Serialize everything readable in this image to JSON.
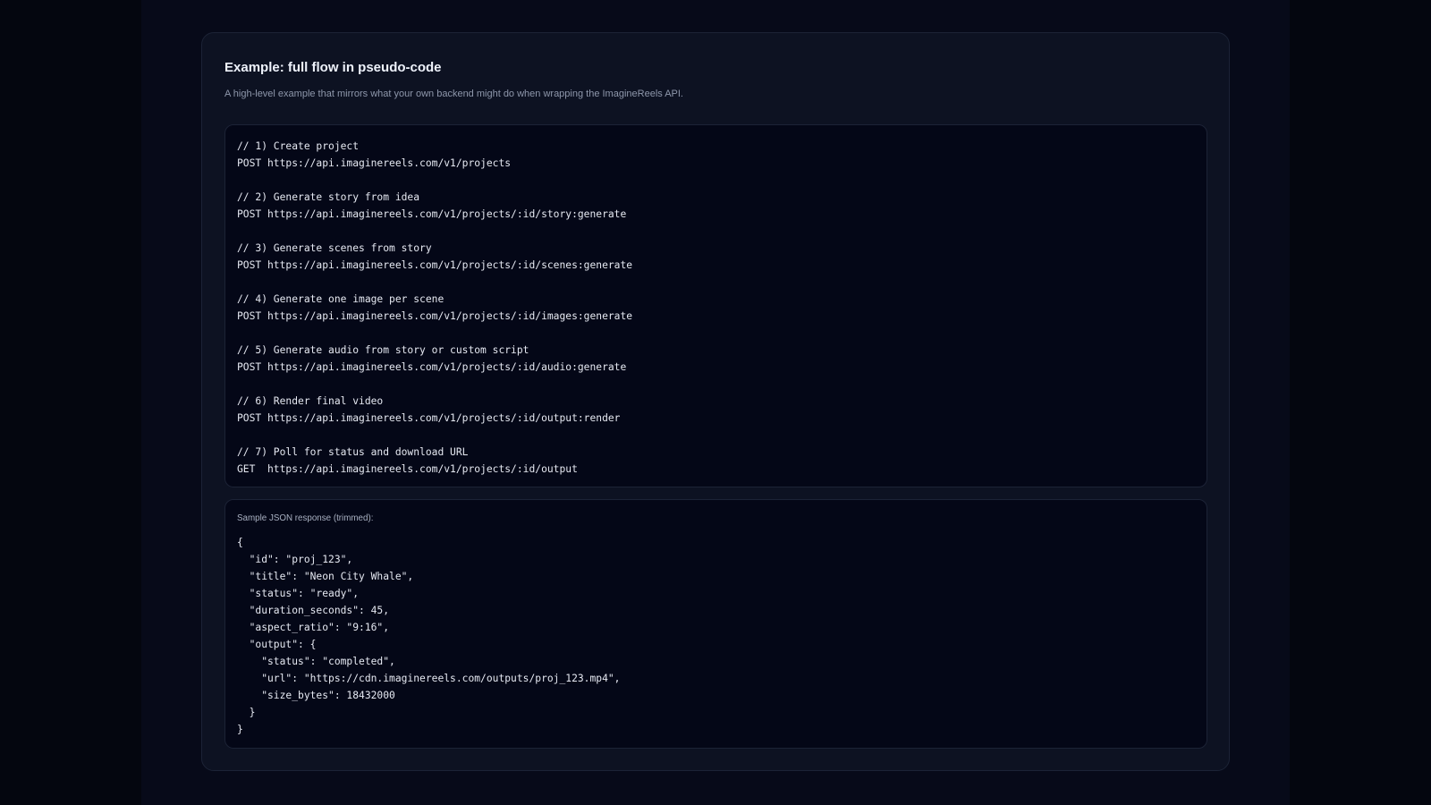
{
  "example_card": {
    "title": "Example: full flow in pseudo-code",
    "subtitle": "A high-level example that mirrors what your own backend might do when wrapping the ImagineReels API.",
    "flow_code": "// 1) Create project\nPOST https://api.imaginereels.com/v1/projects\n\n// 2) Generate story from idea\nPOST https://api.imaginereels.com/v1/projects/:id/story:generate\n\n// 3) Generate scenes from story\nPOST https://api.imaginereels.com/v1/projects/:id/scenes:generate\n\n// 4) Generate one image per scene\nPOST https://api.imaginereels.com/v1/projects/:id/images:generate\n\n// 5) Generate audio from story or custom script\nPOST https://api.imaginereels.com/v1/projects/:id/audio:generate\n\n// 6) Render final video\nPOST https://api.imaginereels.com/v1/projects/:id/output:render\n\n// 7) Poll for status and download URL\nGET  https://api.imaginereels.com/v1/projects/:id/output",
    "json_label": "Sample JSON response (trimmed):",
    "json_code": "{\n  \"id\": \"proj_123\",\n  \"title\": \"Neon City Whale\",\n  \"status\": \"ready\",\n  \"duration_seconds\": 45,\n  \"aspect_ratio\": \"9:16\",\n  \"output\": {\n    \"status\": \"completed\",\n    \"url\": \"https://cdn.imaginereels.com/outputs/proj_123.mp4\",\n    \"size_bytes\": 18432000\n  }\n}"
  }
}
